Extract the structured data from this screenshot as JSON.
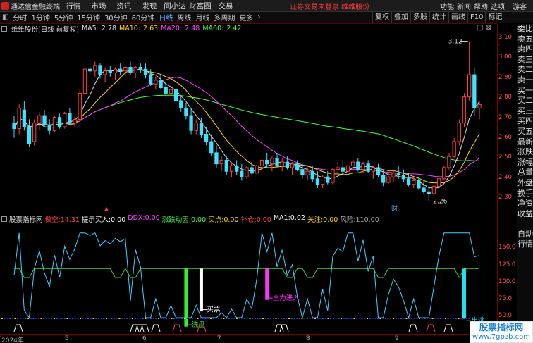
{
  "topbar": {
    "brand": "通达信金融终端",
    "menu": [
      "行情",
      "市场",
      "资讯",
      "发现",
      "问小达",
      "财富圈",
      "交易"
    ],
    "warning": "证券交易未登录 维维股份",
    "right": [
      "功能",
      "新闻",
      "帮助",
      "选项"
    ],
    "guest": "游客"
  },
  "toolbar": {
    "periods": [
      "分时",
      "1分钟",
      "5分钟",
      "15分钟",
      "30分钟",
      "60分钟",
      "日线",
      "周线",
      "月线",
      "多周期",
      "更多"
    ],
    "more_arrow": "›",
    "right_items": [
      "复权",
      "叠加",
      "多股",
      "统计",
      "画线",
      "F10",
      "标记"
    ],
    "window_icons": "□ ⊠"
  },
  "main_header": {
    "title": "维维股份(日线 前复权)",
    "ma5_label": "MA5:",
    "ma5": "2.78",
    "ma10_label": "MA10:",
    "ma10": "2.63",
    "ma20_label": "MA20:",
    "ma20": "2.48",
    "ma60_label": "MA60:",
    "ma60": "2.42"
  },
  "y_axis_main": [
    "3.10",
    "3.00",
    "2.90",
    "2.80",
    "2.70",
    "2.60",
    "2.50",
    "2.40",
    "2.30"
  ],
  "y_axis_ind": [
    "150.0",
    "125.0",
    "100.0",
    "75.0",
    "50.0"
  ],
  "chart_annotations": {
    "high": "3.12",
    "low": "2.26",
    "cai_mark": "财",
    "sell": "洗盘",
    "buy": "买票",
    "main_in": "主力进入",
    "out": "出逃"
  },
  "indicator_header": {
    "name": "股票指标网",
    "items": [
      {
        "label": "做空:",
        "value": "14.31",
        "color": "#ff4444"
      },
      {
        "label": "提示买入:",
        "value": "0.00",
        "color": "#ffffff"
      },
      {
        "label": "DDX:",
        "value": "0.00",
        "color": "#ff44ff"
      },
      {
        "label": "涨跌动因:",
        "value": "0.00",
        "color": "#44ff44"
      },
      {
        "label": "买点:",
        "value": "0.00",
        "color": "#ffd700"
      },
      {
        "label": "补仓:",
        "value": "0.00",
        "color": "#ff4444"
      },
      {
        "label": "MA1:",
        "value": "0.02",
        "color": "#ffffff"
      },
      {
        "label": "关注:",
        "value": "0.00",
        "color": "#ffd700"
      },
      {
        "label": "风险:",
        "value": "110.00",
        "color": "#aaaaaa"
      }
    ]
  },
  "sidebar": [
    "委比",
    "卖五",
    "卖四",
    "卖三",
    "卖二",
    "卖一",
    "买一",
    "买二",
    "买三",
    "买四",
    "买五",
    "最新",
    "涨跌",
    "涨幅",
    "总量",
    "外盘",
    "换手",
    "净资",
    "收益",
    "",
    "自动",
    "行情"
  ],
  "x_axis": [
    "2024年",
    "5",
    "6",
    "7",
    "8",
    "9"
  ],
  "watermark": {
    "line1": "股票指标网",
    "line2": "www.7gpzb.com"
  },
  "colors": {
    "up": "#ff4040",
    "down": "#40e0ff",
    "ma5": "#dddddd",
    "ma10": "#ffd700",
    "ma20": "#ff44ff",
    "ma60": "#44ff44"
  },
  "chart_data": {
    "type": "candlestick",
    "title": "维维股份(日线 前复权)",
    "ylim": [
      2.22,
      3.16
    ],
    "candles": [
      [
        2.68,
        2.72,
        2.6,
        2.65
      ],
      [
        2.65,
        2.78,
        2.62,
        2.76
      ],
      [
        2.75,
        2.8,
        2.64,
        2.66
      ],
      [
        2.66,
        2.7,
        2.55,
        2.57
      ],
      [
        2.58,
        2.7,
        2.56,
        2.68
      ],
      [
        2.68,
        2.74,
        2.64,
        2.72
      ],
      [
        2.72,
        2.75,
        2.66,
        2.67
      ],
      [
        2.67,
        2.7,
        2.62,
        2.64
      ],
      [
        2.64,
        2.72,
        2.63,
        2.71
      ],
      [
        2.71,
        2.73,
        2.65,
        2.66
      ],
      [
        2.66,
        2.74,
        2.65,
        2.73
      ],
      [
        2.73,
        2.76,
        2.67,
        2.68
      ],
      [
        2.68,
        2.72,
        2.66,
        2.7
      ],
      [
        2.7,
        2.86,
        2.69,
        2.84
      ],
      [
        2.84,
        3.0,
        2.82,
        2.97
      ],
      [
        2.97,
        3.02,
        2.94,
        2.96
      ],
      [
        2.96,
        3.01,
        2.93,
        2.99
      ],
      [
        2.99,
        3.0,
        2.92,
        2.94
      ],
      [
        2.94,
        2.98,
        2.9,
        2.96
      ],
      [
        2.96,
        2.99,
        2.93,
        2.95
      ],
      [
        2.95,
        2.98,
        2.91,
        2.97
      ],
      [
        2.97,
        3.0,
        2.94,
        2.96
      ],
      [
        2.96,
        2.99,
        2.93,
        2.98
      ],
      [
        2.98,
        3.01,
        2.94,
        2.95
      ],
      [
        2.95,
        2.99,
        2.92,
        2.98
      ],
      [
        2.98,
        3.0,
        2.95,
        2.97
      ],
      [
        2.97,
        3.0,
        2.92,
        2.94
      ],
      [
        2.94,
        2.97,
        2.88,
        2.89
      ],
      [
        2.89,
        2.93,
        2.86,
        2.91
      ],
      [
        2.91,
        2.94,
        2.86,
        2.87
      ],
      [
        2.87,
        2.9,
        2.82,
        2.84
      ],
      [
        2.84,
        2.88,
        2.8,
        2.86
      ],
      [
        2.86,
        2.88,
        2.78,
        2.8
      ],
      [
        2.8,
        2.83,
        2.74,
        2.76
      ],
      [
        2.76,
        2.79,
        2.7,
        2.72
      ],
      [
        2.72,
        2.76,
        2.62,
        2.64
      ],
      [
        2.64,
        2.7,
        2.62,
        2.68
      ],
      [
        2.68,
        2.71,
        2.6,
        2.62
      ],
      [
        2.62,
        2.66,
        2.56,
        2.58
      ],
      [
        2.58,
        2.62,
        2.5,
        2.52
      ],
      [
        2.52,
        2.56,
        2.44,
        2.46
      ],
      [
        2.46,
        2.5,
        2.42,
        2.48
      ],
      [
        2.48,
        2.5,
        2.4,
        2.42
      ],
      [
        2.42,
        2.47,
        2.39,
        2.45
      ],
      [
        2.45,
        2.48,
        2.4,
        2.42
      ],
      [
        2.42,
        2.46,
        2.37,
        2.39
      ],
      [
        2.39,
        2.45,
        2.38,
        2.44
      ],
      [
        2.44,
        2.47,
        2.4,
        2.41
      ],
      [
        2.41,
        2.46,
        2.4,
        2.45
      ],
      [
        2.45,
        2.5,
        2.43,
        2.48
      ],
      [
        2.48,
        2.52,
        2.44,
        2.46
      ],
      [
        2.46,
        2.5,
        2.42,
        2.49
      ],
      [
        2.49,
        2.52,
        2.44,
        2.45
      ],
      [
        2.45,
        2.49,
        2.42,
        2.47
      ],
      [
        2.47,
        2.5,
        2.43,
        2.44
      ],
      [
        2.44,
        2.47,
        2.4,
        2.46
      ],
      [
        2.46,
        2.48,
        2.42,
        2.43
      ],
      [
        2.43,
        2.46,
        2.38,
        2.4
      ],
      [
        2.4,
        2.44,
        2.37,
        2.42
      ],
      [
        2.42,
        2.45,
        2.36,
        2.38
      ],
      [
        2.38,
        2.42,
        2.33,
        2.35
      ],
      [
        2.35,
        2.4,
        2.33,
        2.39
      ],
      [
        2.39,
        2.42,
        2.35,
        2.36
      ],
      [
        2.36,
        2.44,
        2.35,
        2.43
      ],
      [
        2.43,
        2.47,
        2.4,
        2.44
      ],
      [
        2.44,
        2.48,
        2.41,
        2.42
      ],
      [
        2.42,
        2.46,
        2.38,
        2.45
      ],
      [
        2.45,
        2.5,
        2.43,
        2.47
      ],
      [
        2.47,
        2.49,
        2.42,
        2.43
      ],
      [
        2.43,
        2.47,
        2.41,
        2.46
      ],
      [
        2.46,
        2.48,
        2.41,
        2.42
      ],
      [
        2.42,
        2.45,
        2.38,
        2.44
      ],
      [
        2.44,
        2.46,
        2.39,
        2.4
      ],
      [
        2.4,
        2.43,
        2.34,
        2.36
      ],
      [
        2.36,
        2.41,
        2.35,
        2.39
      ],
      [
        2.39,
        2.43,
        2.36,
        2.41
      ],
      [
        2.41,
        2.45,
        2.38,
        2.4
      ],
      [
        2.4,
        2.43,
        2.36,
        2.38
      ],
      [
        2.38,
        2.41,
        2.34,
        2.35
      ],
      [
        2.35,
        2.39,
        2.33,
        2.37
      ],
      [
        2.37,
        2.39,
        2.32,
        2.33
      ],
      [
        2.33,
        2.37,
        2.3,
        2.31
      ],
      [
        2.31,
        2.34,
        2.26,
        2.3
      ],
      [
        2.3,
        2.36,
        2.29,
        2.34
      ],
      [
        2.34,
        2.4,
        2.33,
        2.38
      ],
      [
        2.38,
        2.45,
        2.37,
        2.44
      ],
      [
        2.44,
        2.52,
        2.43,
        2.5
      ],
      [
        2.5,
        2.6,
        2.49,
        2.58
      ],
      [
        2.58,
        2.7,
        2.56,
        2.68
      ],
      [
        2.68,
        2.84,
        2.66,
        2.82
      ],
      [
        2.82,
        3.12,
        2.8,
        2.94
      ],
      [
        2.94,
        2.98,
        2.72,
        2.76
      ],
      [
        2.76,
        2.8,
        2.7,
        2.78
      ]
    ],
    "risk_line_level": 110,
    "indicator_ylim": [
      40,
      160
    ]
  }
}
